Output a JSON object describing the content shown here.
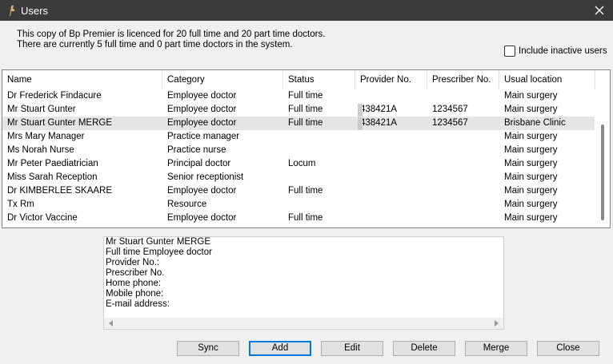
{
  "window": {
    "title": "Users"
  },
  "info": {
    "line1": "This copy of Bp Premier is licenced for 20 full time and 20 part time doctors.",
    "line2": "There are currently 5 full time and 0 part time doctors in the system."
  },
  "include_inactive": {
    "label": "Include inactive users",
    "checked": false
  },
  "columns": [
    "Name",
    "Category",
    "Status",
    "Provider No.",
    "Prescriber No.",
    "Usual location"
  ],
  "rows": [
    {
      "name": "Dr Frederick Findacure",
      "category": "Employee doctor",
      "status": "Full time",
      "provider": "",
      "prescriber": "",
      "location": "Main surgery"
    },
    {
      "name": "Mr Stuart Gunter",
      "category": "Employee doctor",
      "status": "Full time",
      "provider": "438421A",
      "prescriber": "1234567",
      "location": "Main surgery"
    },
    {
      "name": "Mr Stuart Gunter MERGE",
      "category": "Employee doctor",
      "status": "Full time",
      "provider": "438421A",
      "prescriber": "1234567",
      "location": "Brisbane Clinic"
    },
    {
      "name": "Mrs Mary Manager",
      "category": "Practice manager",
      "status": "",
      "provider": "",
      "prescriber": "",
      "location": "Main surgery"
    },
    {
      "name": "Ms Norah Nurse",
      "category": "Practice nurse",
      "status": "",
      "provider": "",
      "prescriber": "",
      "location": "Main surgery"
    },
    {
      "name": "Mr Peter Paediatrician",
      "category": "Principal doctor",
      "status": "Locum",
      "provider": "",
      "prescriber": "",
      "location": "Main surgery"
    },
    {
      "name": "Miss Sarah Reception",
      "category": "Senior receptionist",
      "status": "",
      "provider": "",
      "prescriber": "",
      "location": "Main surgery"
    },
    {
      "name": "Dr KIMBERLEE SKAARE",
      "category": "Employee doctor",
      "status": "Full time",
      "provider": "",
      "prescriber": "",
      "location": "Main surgery"
    },
    {
      "name": "Tx Rm",
      "category": "Resource",
      "status": "",
      "provider": "",
      "prescriber": "",
      "location": "Main surgery"
    },
    {
      "name": "Dr Victor Vaccine",
      "category": "Employee doctor",
      "status": "Full time",
      "provider": "",
      "prescriber": "",
      "location": "Main surgery"
    }
  ],
  "selected_row": 2,
  "detail": {
    "lines": [
      "Mr Stuart Gunter MERGE",
      "Full time Employee doctor",
      "Provider No.:",
      "Prescriber No.",
      "Home phone:",
      "Mobile phone:",
      "E-mail address:"
    ]
  },
  "buttons": {
    "sync": "Sync",
    "add": "Add",
    "edit": "Edit",
    "delete": "Delete",
    "merge": "Merge",
    "close": "Close"
  }
}
